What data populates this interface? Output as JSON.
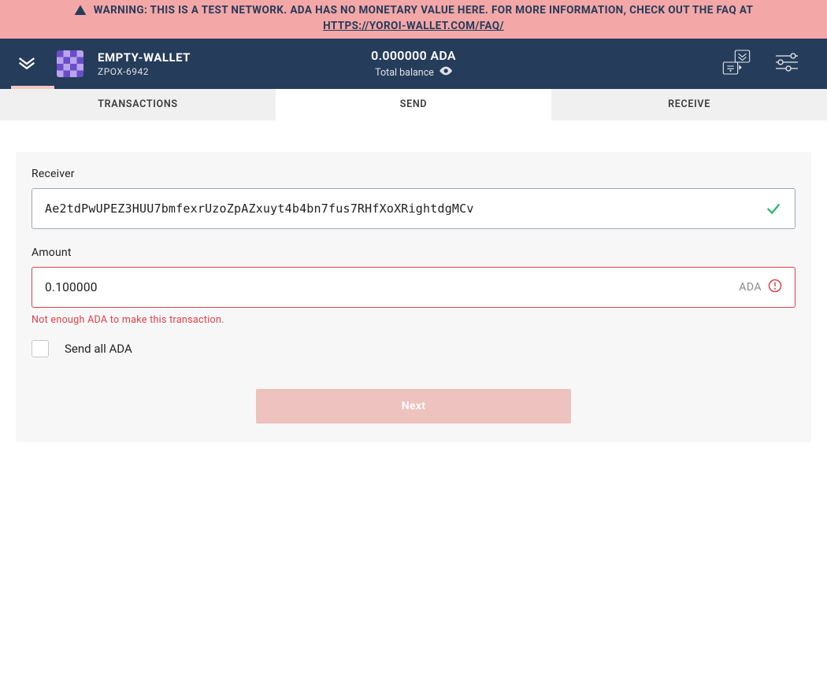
{
  "banner": {
    "text": "WARNING: THIS IS A TEST NETWORK. ADA HAS NO MONETARY VALUE HERE. FOR MORE INFORMATION, CHECK OUT THE FAQ AT",
    "link_text": "HTTPS://YOROI-WALLET.COM/FAQ/",
    "icon": "warning-icon"
  },
  "header": {
    "wallet_name": "EMPTY-WALLET",
    "wallet_sub": "ZPOX-6942",
    "balance_amount": "0.000000 ADA",
    "balance_sub": "Total balance"
  },
  "tabs": {
    "transactions": "TRANSACTIONS",
    "send": "SEND",
    "receive": "RECEIVE",
    "active": "send"
  },
  "form": {
    "receiver_label": "Receiver",
    "receiver_value": "Ae2tdPwUPEZ3HUU7bmfexrUzoZpAZxuyt4b4bn7fus7RHfXoXRightdgMCv",
    "receiver_valid": true,
    "amount_label": "Amount",
    "amount_value": "0.100000",
    "amount_currency": "ADA",
    "amount_error": "Not enough ADA to make this transaction.",
    "send_all_label": "Send all ADA",
    "send_all_checked": false,
    "next_label": "Next",
    "next_disabled": true
  },
  "colors": {
    "banner_bg": "#f4a7a7",
    "header_bg": "#253c5b",
    "error": "#e0414a",
    "success": "#28b96f",
    "disabled_btn_bg": "#eec2bf"
  }
}
